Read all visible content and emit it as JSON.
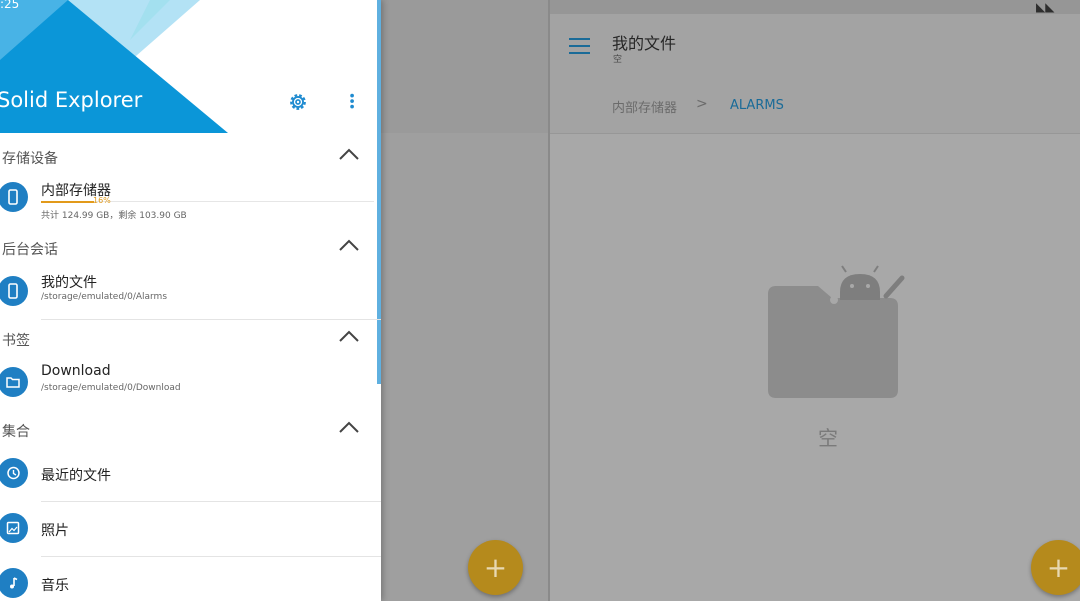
{
  "status": {
    "time": ":25"
  },
  "drawer": {
    "app_title": "Solid Explorer",
    "sections": [
      {
        "title": "存储设备"
      },
      {
        "title": "后台会话"
      },
      {
        "title": "书签"
      },
      {
        "title": "集合"
      }
    ],
    "storage": {
      "label": "内部存储器",
      "percent_text": "16%",
      "percent": 16,
      "info": "共计 124.99 GB，剩余 103.90 GB"
    },
    "session": {
      "label": "我的文件",
      "path": "/storage/emulated/0/Alarms"
    },
    "bookmark": {
      "label": "Download",
      "path": "/storage/emulated/0/Download"
    },
    "collections": [
      {
        "label": "最近的文件",
        "icon": "history-icon"
      },
      {
        "label": "照片",
        "icon": "image-icon"
      },
      {
        "label": "音乐",
        "icon": "music-icon"
      }
    ]
  },
  "main": {
    "title": "我的文件",
    "subtitle": "空",
    "breadcrumb": [
      "内部存储器",
      "ALARMS"
    ],
    "breadcrumb_sep": ">",
    "empty_text": "空",
    "fab_label": "+"
  },
  "colors": {
    "accent": "#1f7fc3",
    "fab": "#f0ad1e",
    "storage_bar": "#e29a1a"
  }
}
